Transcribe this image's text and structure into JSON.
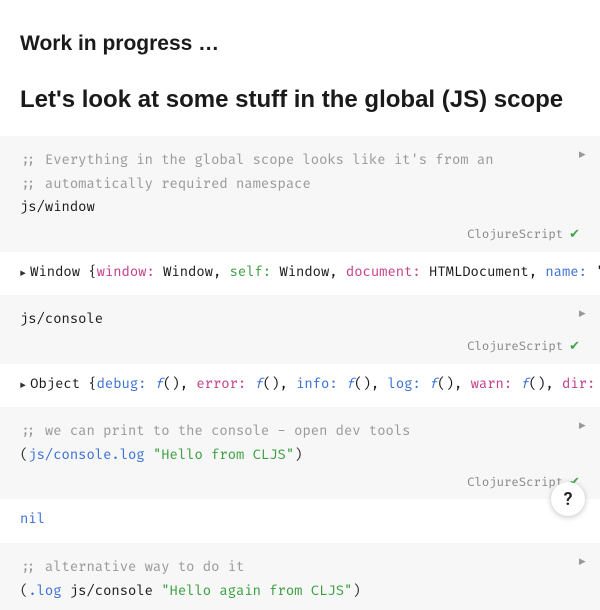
{
  "headings": {
    "wip": "Work in progress …",
    "section": "Let's look at some stuff in the global (JS) scope"
  },
  "lang": "ClojureScript",
  "cells": {
    "c1": {
      "line1": ";; Everything in the global scope looks like it's from an",
      "line2": ";; automatically required namespace",
      "line3": "js/window"
    },
    "c2": {
      "line1": "js/console"
    },
    "c3": {
      "line1": ";; we can print to the console - open dev tools",
      "fn": "js/console.log",
      "arg": "\"Hello from CLJS\""
    },
    "c4": {
      "line1": ";; alternative way to do it",
      "fn": ".log",
      "ns": "js/console",
      "arg": "\"Hello again from CLJS\""
    }
  },
  "outputs": {
    "o1": {
      "prefix": "Window {",
      "k1": "window:",
      "v1": "Window",
      "k2": "self:",
      "v2": "Window",
      "k3": "document:",
      "v3": "HTMLDocument",
      "k4": "name:",
      "v4": "'"
    },
    "o2": {
      "prefix": "Object {",
      "k1": "debug:",
      "k2": "error:",
      "k3": "info:",
      "k4": "log:",
      "k5": "warn:",
      "k6": "dir:",
      "call": "()"
    },
    "o3": {
      "val": "nil"
    }
  },
  "help": "?"
}
